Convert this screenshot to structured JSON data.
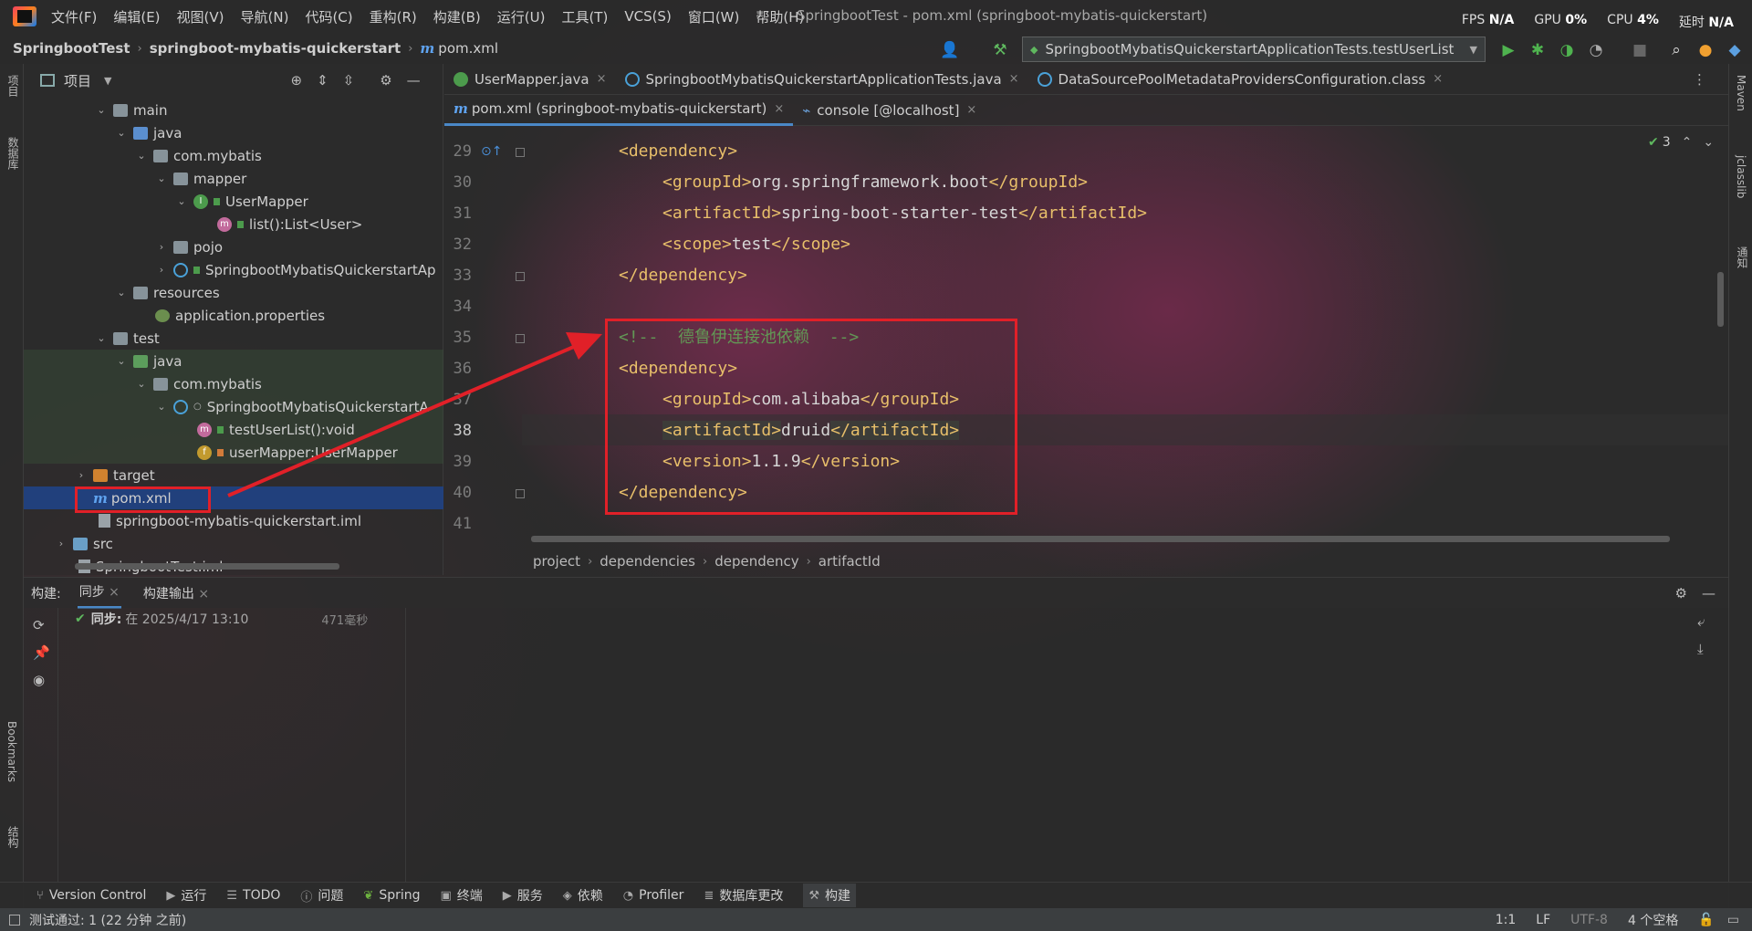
{
  "menu": [
    "文件(F)",
    "编辑(E)",
    "视图(V)",
    "导航(N)",
    "代码(C)",
    "重构(R)",
    "构建(B)",
    "运行(U)",
    "工具(T)",
    "VCS(S)",
    "窗口(W)",
    "帮助(H)"
  ],
  "window_title": "SpringbootTest - pom.xml (springboot-mybatis-quickerstart)",
  "perf": {
    "fps_label": "FPS",
    "fps": "N/A",
    "gpu_label": "GPU",
    "gpu": "0%",
    "cpu_label": "CPU",
    "cpu": "4%",
    "delay_label": "延时",
    "delay": "N/A"
  },
  "nav": {
    "project": "SpringbootTest",
    "module": "springboot-mybatis-quickerstart",
    "file": "pom.xml"
  },
  "run_config": "SpringbootMybatisQuickerstartApplicationTests.testUserList",
  "left_stripe": {
    "project": "项目",
    "database": "数据库",
    "bookmarks": "Bookmarks",
    "structure": "结构"
  },
  "right_stripe": {
    "maven": "Maven",
    "jclasslib": "jclasslib",
    "notify": "通知"
  },
  "project_panel": {
    "title": "项目"
  },
  "tree": [
    {
      "label": "main"
    },
    {
      "label": "java"
    },
    {
      "label": "com.mybatis"
    },
    {
      "label": "mapper"
    },
    {
      "label": "UserMapper"
    },
    {
      "label": "list():List<User>"
    },
    {
      "label": "pojo"
    },
    {
      "label": "SpringbootMybatisQuickerstartAp"
    },
    {
      "label": "resources"
    },
    {
      "label": "application.properties"
    },
    {
      "label": "test"
    },
    {
      "label": "java"
    },
    {
      "label": "com.mybatis"
    },
    {
      "label": "SpringbootMybatisQuickerstartA"
    },
    {
      "label": "testUserList():void"
    },
    {
      "label": "userMapper:UserMapper"
    },
    {
      "label": "target"
    },
    {
      "label": "pom.xml"
    },
    {
      "label": "springboot-mybatis-quickerstart.iml"
    },
    {
      "label": "src"
    },
    {
      "label": "SpringbootTest.iml"
    }
  ],
  "tabs_row1": [
    {
      "label": "UserMapper.java"
    },
    {
      "label": "SpringbootMybatisQuickerstartApplicationTests.java"
    },
    {
      "label": "DataSourcePoolMetadataProvidersConfiguration.class"
    }
  ],
  "tabs_row2": [
    {
      "label": "pom.xml (springboot-mybatis-quickerstart)"
    },
    {
      "label": "console [@localhost]"
    }
  ],
  "inspection_count": "3",
  "line_numbers": [
    "29",
    "30",
    "31",
    "32",
    "33",
    "34",
    "35",
    "36",
    "37",
    "38",
    "39",
    "40",
    "41"
  ],
  "code": {
    "l29": "<dependency>",
    "l30_open": "<groupId>",
    "l30_val": "org.springframework.boot",
    "l30_close": "</groupId>",
    "l31_open": "<artifactId>",
    "l31_val": "spring-boot-starter-test",
    "l31_close": "</artifactId>",
    "l32_open": "<scope>",
    "l32_val": "test",
    "l32_close": "</scope>",
    "l33": "</dependency>",
    "l35": "<!--  德鲁伊连接池依赖  -->",
    "l36": "<dependency>",
    "l37_open": "<groupId>",
    "l37_val": "com.alibaba",
    "l37_close": "</groupId>",
    "l38_open": "<artifactId>",
    "l38_val": "druid",
    "l38_close": "</artifactId>",
    "l39_open": "<version>",
    "l39_val": "1.1.9",
    "l39_close": "</version>",
    "l40": "</dependency>"
  },
  "breadcrumb": [
    "project",
    "dependencies",
    "dependency",
    "artifactId"
  ],
  "build": {
    "label": "构建:",
    "tab_sync": "同步",
    "tab_output": "构建输出",
    "sync_title": "同步:",
    "sync_time": "在 2025/4/17 13:10",
    "duration": "471毫秒"
  },
  "tool_windows": [
    "Version Control",
    "运行",
    "TODO",
    "问题",
    "Spring",
    "终端",
    "服务",
    "依赖",
    "Profiler",
    "数据库更改",
    "构建"
  ],
  "status": {
    "message": "测试通过: 1 (22 分钟 之前)",
    "position": "1:1",
    "line_sep": "LF",
    "encoding": "UTF-8",
    "indent": "4 个空格"
  }
}
